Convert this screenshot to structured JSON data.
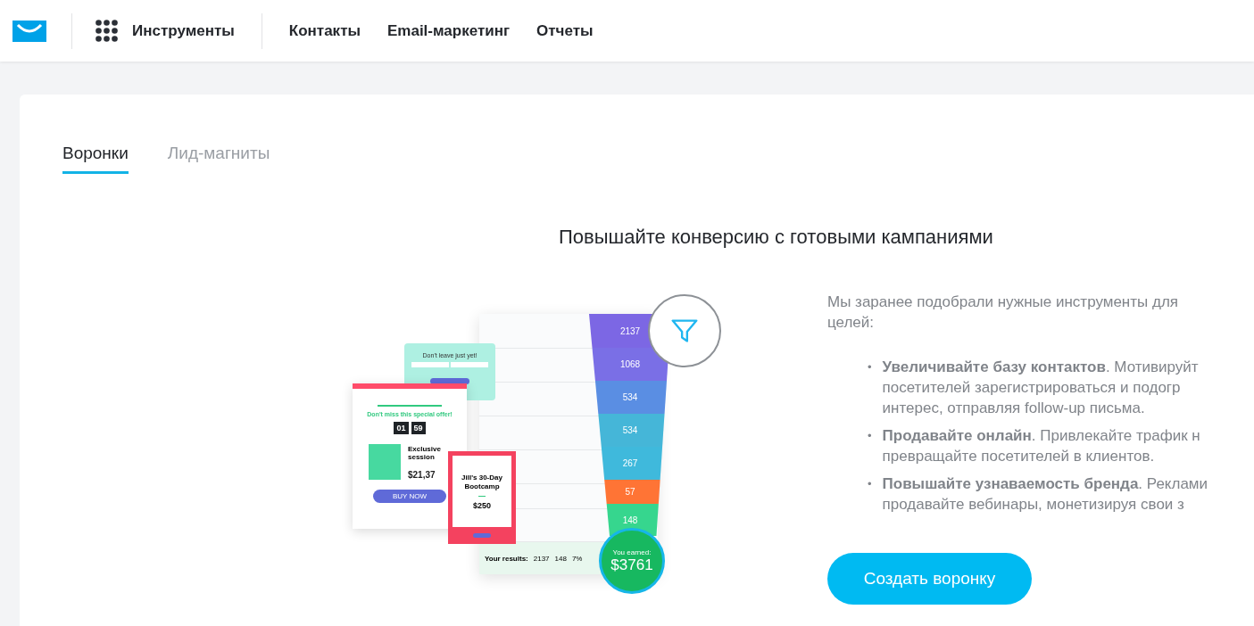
{
  "header": {
    "tools_label": "Инструменты",
    "nav": [
      {
        "label": "Контакты"
      },
      {
        "label": "Email-маркетинг"
      },
      {
        "label": "Отчеты"
      }
    ]
  },
  "tabs": [
    {
      "label": "Воронки",
      "selected": true
    },
    {
      "label": "Лид-магниты",
      "selected": false
    }
  ],
  "heading": "Повышайте конверсию с готовыми кампаниями",
  "illustration": {
    "funnel_steps": [
      {
        "value": "2137",
        "color": "#7c67e4"
      },
      {
        "value": "1068",
        "color": "#7a6fe6"
      },
      {
        "value": "534",
        "color": "#5a8ee3"
      },
      {
        "value": "534",
        "color": "#45b6d8"
      },
      {
        "value": "267",
        "color": "#3fb9dc"
      },
      {
        "value": "57",
        "color": "#ff7435"
      },
      {
        "value": "148",
        "color": "#36d68e"
      }
    ],
    "earned": {
      "label": "You earned:",
      "amount": "$3761"
    },
    "popup": {
      "title": "Don't leave just yet!"
    },
    "offer": {
      "title": "Don't miss this special offer!",
      "timer": [
        "01",
        "59"
      ],
      "session": "Exclusive session",
      "price": "$21,37",
      "button": "BUY NOW"
    },
    "product": {
      "title": "Jill's 30-Day Bootcamp",
      "price": "$250"
    },
    "results": {
      "label": "Your results:",
      "values": [
        "2137",
        "148",
        "7%"
      ]
    }
  },
  "intro": [
    "Мы заранее подобрали нужные инструменты для",
    "целей:"
  ],
  "bullets": [
    {
      "marker": "•",
      "lines": [
        "**Увеличивайте базу контактов**. Мотивируйт",
        "посетителей зарегистрироваться и подогр",
        "интерес, отправляя follow-up письма."
      ]
    },
    {
      "marker": "•",
      "lines": [
        "**Продавайте онлайн**. Привлекайте трафик н",
        "превращайте посетителей в клиентов."
      ]
    },
    {
      "marker": "•",
      "lines": [
        "**Повышайте узнаваемость бренда**. Реклами",
        "продавайте вебинары, монетизируя свои з"
      ]
    }
  ],
  "cta": {
    "label": "Создать воронку"
  }
}
